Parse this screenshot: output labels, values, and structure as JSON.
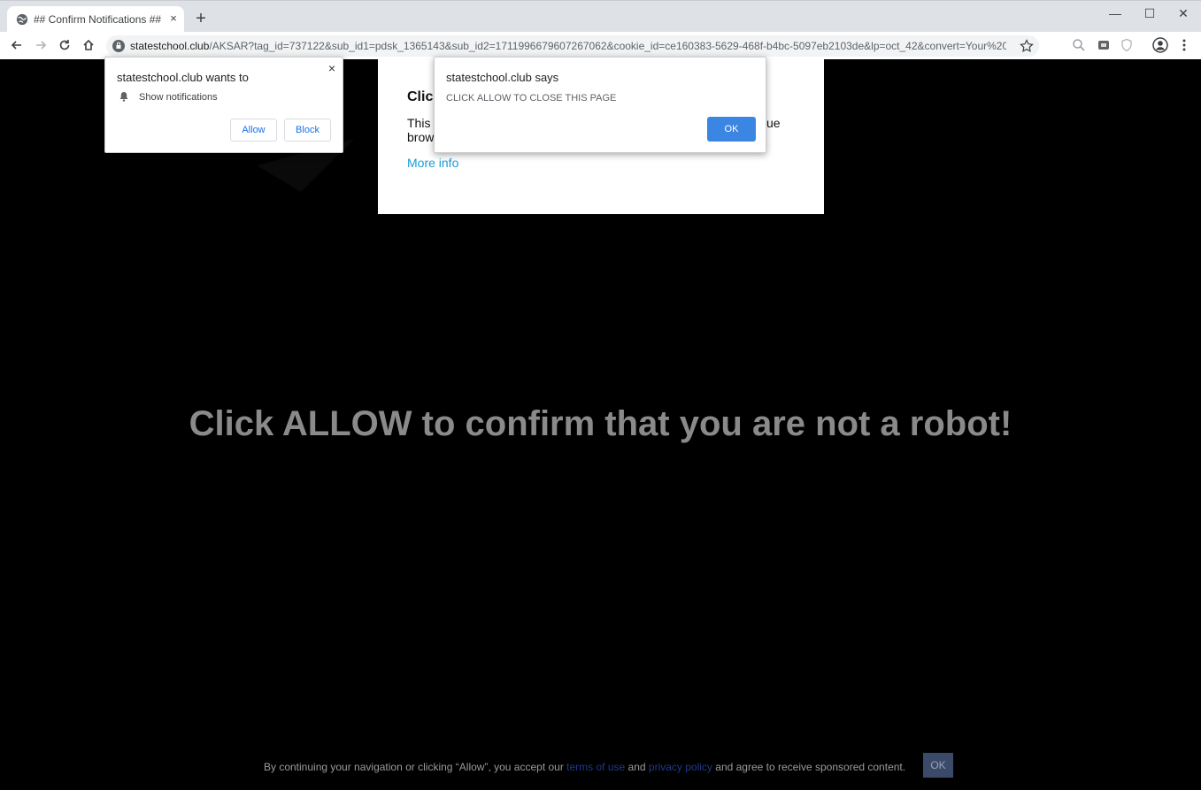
{
  "browser": {
    "tab_title": "## Confirm Notifications ##",
    "tab_close": "×",
    "new_tab": "+",
    "win_min": "—",
    "win_max": "☐",
    "win_close": "✕",
    "url_host": "statestchool.club",
    "url_rest": "/AKSAR?tag_id=737122&sub_id1=pdsk_1365143&sub_id2=1711996679607267062&cookie_id=ce160383-5629-468f-b4bc-5097eb2103de&lp=oct_42&convert=Your%20Vid..."
  },
  "page": {
    "hero_text": "Click ALLOW to confirm that you are not a robot!",
    "card_title": "Clic",
    "card_text_start": "This",
    "card_text_line2": "brow",
    "card_text_end": "ue",
    "card_link": "More info",
    "footer_prefix": "By continuing your navigation or clicking “Allow”, you accept our ",
    "footer_terms": "terms of use",
    "footer_and": " and ",
    "footer_privacy": "privacy policy",
    "footer_suffix": " and agree to receive sponsored content.",
    "footer_ok": "OK"
  },
  "permission_dialog": {
    "title": "statestchool.club wants to",
    "close": "×",
    "item": "Show notifications",
    "allow_label": "Allow",
    "block_label": "Block"
  },
  "alert_dialog": {
    "title": "statestchool.club says",
    "message": "CLICK ALLOW TO CLOSE THIS PAGE",
    "ok_label": "OK"
  }
}
